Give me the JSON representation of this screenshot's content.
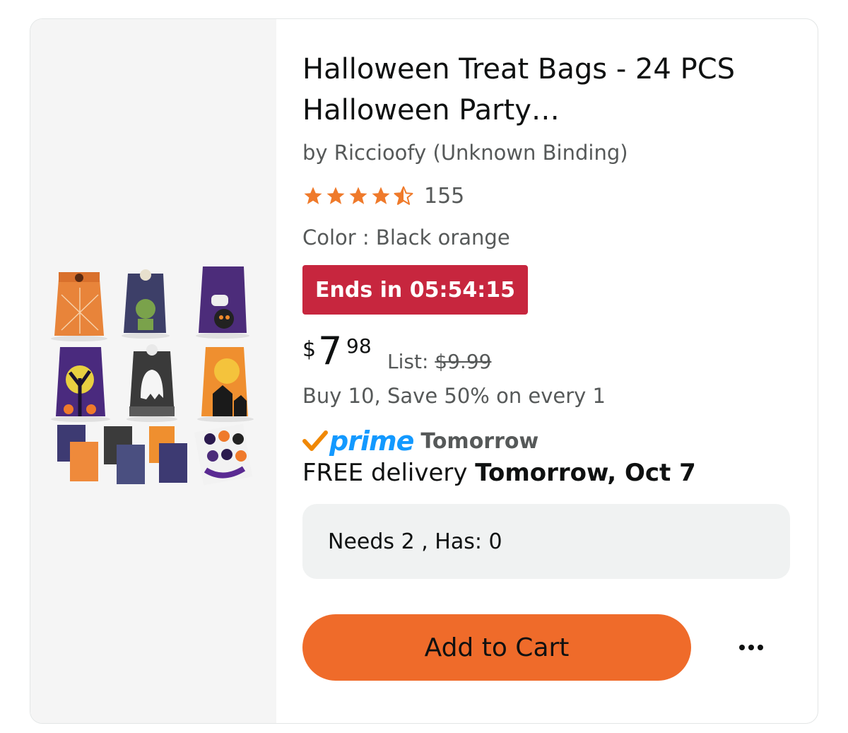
{
  "product": {
    "title": "Halloween Treat Bags - 24 PCS Halloween Party…",
    "byline": "by Riccioofy (Unknown Binding)",
    "rating": {
      "stars": 4.5,
      "count": "155"
    },
    "color_line": "Color : Black orange",
    "deal_badge": "Ends in 05:54:15",
    "price": {
      "currency": "$",
      "whole": "7",
      "fraction": "98",
      "list_label": "List:",
      "list_price": "$9.99"
    },
    "bulk_offer": "Buy 10, Save 50% on every 1",
    "prime": {
      "logo": "prime",
      "day": "Tomorrow"
    },
    "delivery": {
      "prefix": "FREE delivery",
      "date": "Tomorrow, Oct 7"
    },
    "needs_status": "Needs 2 , Has: 0",
    "add_to_cart_label": "Add to Cart",
    "more_options_icon": "more-horizontal-icon"
  },
  "colors": {
    "deal_badge": "#c7263e",
    "button": "#ef6b2a",
    "star": "#ef7a2b",
    "prime_blue": "#1399ff",
    "prime_check": "#f08804"
  }
}
